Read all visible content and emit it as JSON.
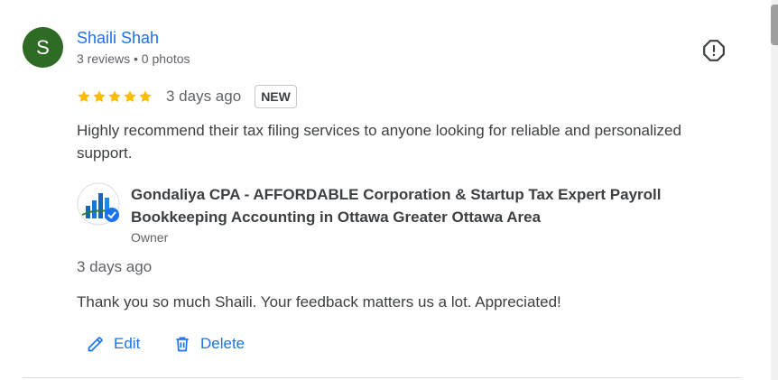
{
  "review": {
    "avatar_letter": "S",
    "avatar_color": "#2e6b24",
    "reviewer_name": "Shaili Shah",
    "reviewer_meta": "3 reviews • 0 photos",
    "rating": 5,
    "date": "3 days ago",
    "badge": "NEW",
    "text": "Highly recommend their tax filing services to anyone looking for reliable and personalized support."
  },
  "owner_reply": {
    "business_name": "Gondaliya CPA - AFFORDABLE Corporation & Startup Tax Expert Payroll Bookkeeping Accounting in Ottawa Greater Ottawa Area",
    "role": "Owner",
    "date": "3 days ago",
    "text": "Thank you so much Shaili. Your feedback matters us a lot. Appreciated!"
  },
  "actions": {
    "edit_label": "Edit",
    "delete_label": "Delete"
  },
  "icons": {
    "report": "report-flag-icon",
    "edit": "pencil-icon",
    "delete": "trash-icon",
    "star": "star-icon"
  },
  "colors": {
    "link": "#1a73e8",
    "star": "#fbbc04",
    "text": "#3c4043",
    "muted": "#5f6368"
  }
}
